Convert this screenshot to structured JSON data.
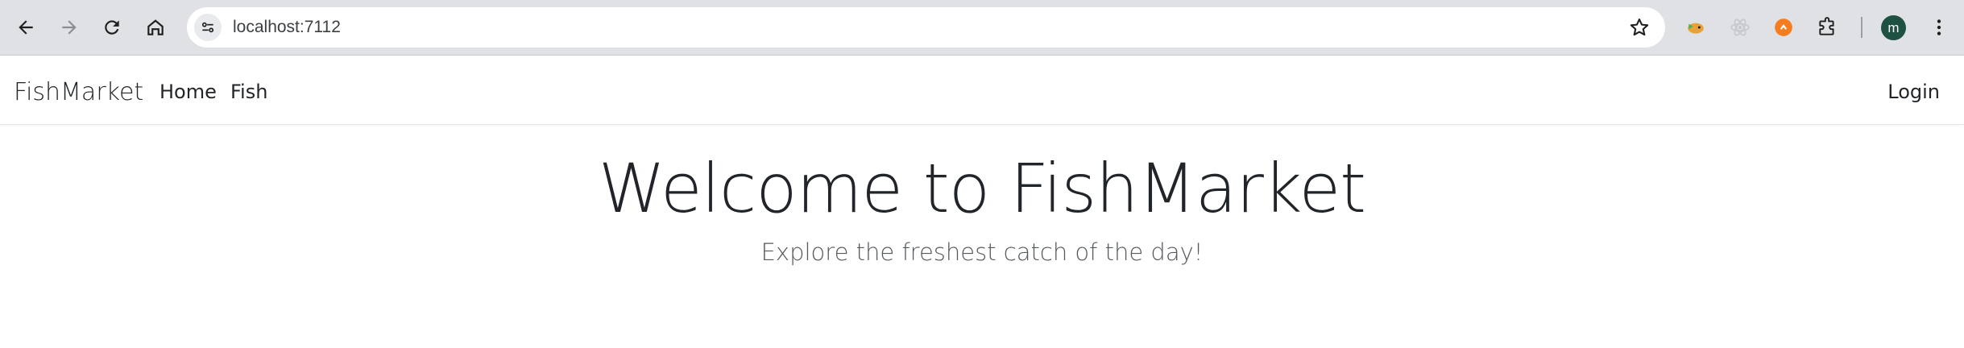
{
  "browser": {
    "url": "localhost:7112",
    "profile_initial": "m",
    "icons": [
      "back-icon",
      "forward-icon",
      "reload-icon",
      "home-icon",
      "site-info-icon",
      "bookmark-star-icon",
      "extension-fish-icon",
      "extension-react-icon",
      "extension-orange-icon",
      "extensions-puzzle-icon",
      "menu-dots-icon"
    ]
  },
  "navbar": {
    "brand": "FishMarket",
    "links": [
      "Home",
      "Fish"
    ],
    "login": "Login"
  },
  "hero": {
    "title": "Welcome to FishMarket",
    "subtitle": "Explore the freshest catch of the day!"
  },
  "colors": {
    "chrome_bg": "#dfe1e5",
    "avatar_bg": "#1e5142",
    "text": "#212529"
  }
}
